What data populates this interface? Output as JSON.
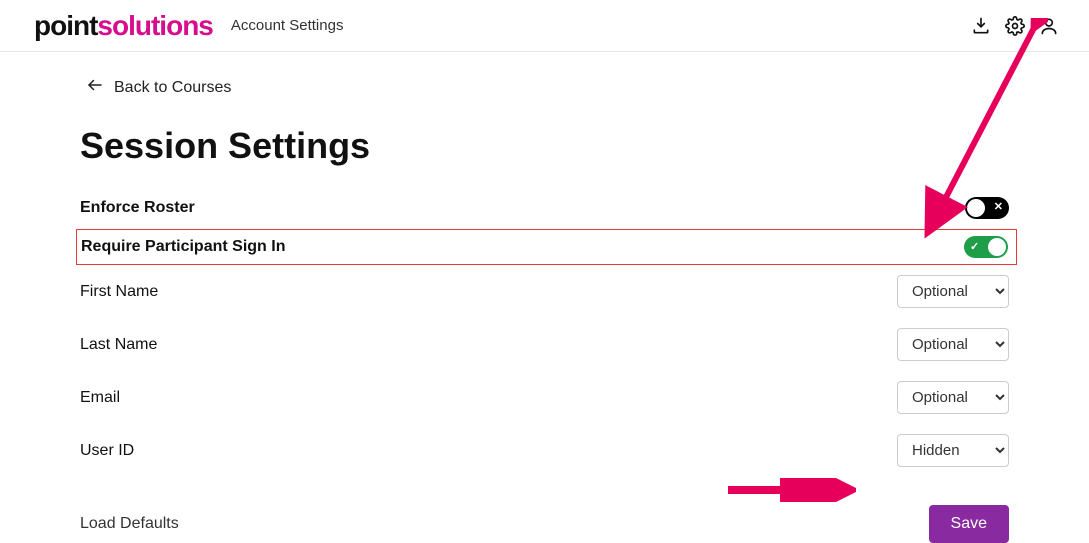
{
  "header": {
    "logo_bold": "point",
    "logo_accent": "solutions",
    "breadcrumb": "Account Settings"
  },
  "back_link": "Back to Courses",
  "page_title": "Session Settings",
  "rows": {
    "enforce_roster": {
      "label": "Enforce Roster",
      "state": "off"
    },
    "require_signin": {
      "label": "Require Participant Sign In",
      "state": "on"
    },
    "first_name": {
      "label": "First Name",
      "value": "Optional"
    },
    "last_name": {
      "label": "Last Name",
      "value": "Optional"
    },
    "email": {
      "label": "Email",
      "value": "Optional"
    },
    "user_id": {
      "label": "User ID",
      "value": "Hidden"
    }
  },
  "footer": {
    "load_defaults": "Load Defaults",
    "save": "Save"
  },
  "colors": {
    "brand_accent": "#d60d8c",
    "toggle_on": "#1e9e49",
    "primary_btn": "#8a2aa0",
    "highlight_border": "#e33b3b"
  }
}
